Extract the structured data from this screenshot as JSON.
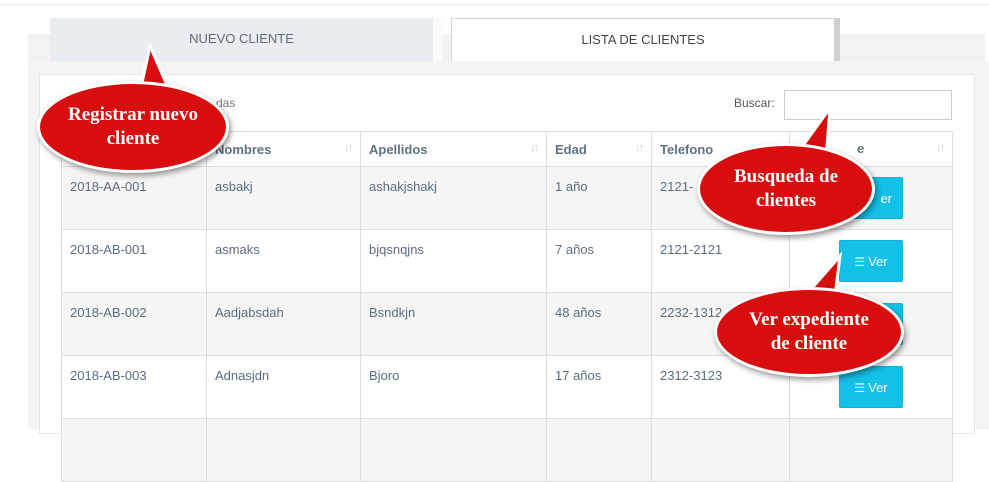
{
  "tabs": {
    "nuevo_cliente": "NUEVO CLIENTE",
    "lista_clientes": "LISTA DE CLIENTES"
  },
  "controls": {
    "show_fragment": "das",
    "search_label": "Buscar:",
    "search_value": ""
  },
  "table": {
    "headers": {
      "nombres": "Nombres",
      "apellidos": "Apellidos",
      "edad": "Edad",
      "telefono": "Telefono",
      "accion_fragment": "e"
    },
    "rows": [
      {
        "codigo": "2018-AA-001",
        "nombres": "asbakj",
        "apellidos": "ashakjshakj",
        "edad": "1 año",
        "telefono": "2121-"
      },
      {
        "codigo": "2018-AB-001",
        "nombres": "asmaks",
        "apellidos": "bjqsnqjns",
        "edad": "7 años",
        "telefono": "2121-2121"
      },
      {
        "codigo": "2018-AB-002",
        "nombres": "Aadjabsdah",
        "apellidos": "Bsndkjn",
        "edad": "48 años",
        "telefono": "2232-1312"
      },
      {
        "codigo": "2018-AB-003",
        "nombres": "Adnasjdn",
        "apellidos": "Bjoro",
        "edad": "17 años",
        "telefono": "2312-3123"
      }
    ],
    "button_label": "Ver",
    "button_fragment": "er"
  },
  "callouts": {
    "registrar_line1": "Registrar nuevo",
    "registrar_line2": "cliente",
    "busqueda_line1": "Busqueda de",
    "busqueda_line2": "clientes",
    "expediente_line1": "Ver expediente",
    "expediente_line2": "de cliente"
  },
  "colors": {
    "button": "#13c0e6",
    "callout": "#d80d0d"
  },
  "icons": {
    "sort": "sort-arrows-icon",
    "button": "list-icon"
  }
}
